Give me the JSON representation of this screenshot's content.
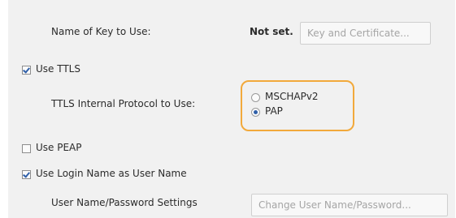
{
  "key": {
    "label": "Name of Key to Use:",
    "value": "Not set.",
    "button": "Key and Certificate..."
  },
  "ttls": {
    "checkbox_label": "Use TTLS",
    "checked": true,
    "protocol_label": "TTLS Internal Protocol to Use:",
    "options": [
      "MSCHAPv2",
      "PAP"
    ],
    "selected": "PAP",
    "highlight_color": "#f2a93b"
  },
  "peap": {
    "checkbox_label": "Use PEAP",
    "checked": false
  },
  "login": {
    "checkbox_label": "Use Login Name as User Name",
    "checked": true
  },
  "credentials": {
    "label": "User Name/Password Settings",
    "button": "Change User Name/Password..."
  }
}
